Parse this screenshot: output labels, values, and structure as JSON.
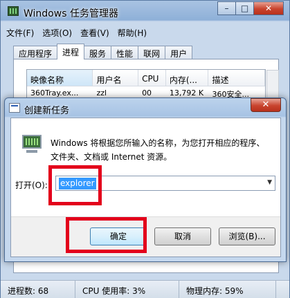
{
  "task_manager": {
    "title": "Windows 任务管理器",
    "menu": [
      "文件(F)",
      "选项(O)",
      "查看(V)",
      "帮助(H)"
    ],
    "tabs": [
      "应用程序",
      "进程",
      "服务",
      "性能",
      "联网",
      "用户"
    ],
    "active_tab": "进程",
    "columns": [
      "映像名称",
      "用户名",
      "CPU",
      "内存(...",
      "描述"
    ],
    "rows": [
      [
        "360Tray.ex...",
        "zzl",
        "00",
        "13,792 K",
        "360安全..."
      ]
    ],
    "status": {
      "processes": "进程数: 68",
      "cpu": "CPU 使用率: 3%",
      "memory": "物理内存: 59%"
    }
  },
  "run_dialog": {
    "title": "创建新任务",
    "description": "Windows 将根据您所输入的名称，为您打开相应的程序、文件夹、文档或 Internet 资源。",
    "open_label": "打开(O):",
    "input_value": "explorer",
    "ok_label": "确定",
    "cancel_label": "取消",
    "browse_label": "浏览(B)..."
  },
  "highlight_color": "#e3001b"
}
